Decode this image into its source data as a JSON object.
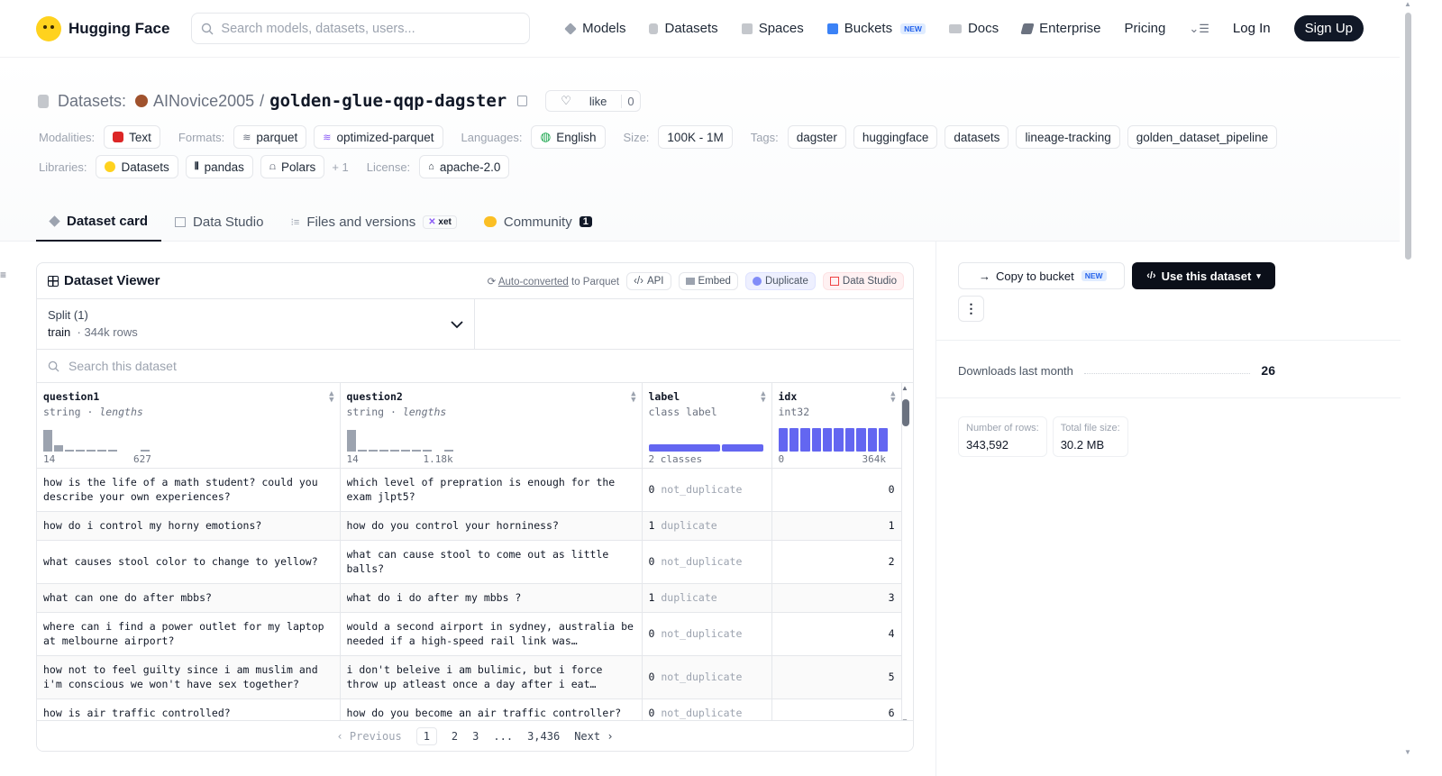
{
  "nav": {
    "brand": "Hugging Face",
    "search_placeholder": "Search models, datasets, users...",
    "links": [
      {
        "label": "Models",
        "color": "#9ca3af"
      },
      {
        "label": "Datasets",
        "color": "#9ca3af"
      },
      {
        "label": "Spaces",
        "color": "#9ca3af"
      },
      {
        "label": "Buckets",
        "color": "#3b82f6",
        "badge": "NEW"
      },
      {
        "label": "Docs",
        "color": "#9ca3af"
      },
      {
        "label": "Enterprise",
        "color": "#6b7280"
      },
      {
        "label": "Pricing"
      }
    ],
    "login": "Log In",
    "signup": "Sign Up"
  },
  "header": {
    "section_label": "Datasets:",
    "owner": "AINovice2005",
    "separator": "/",
    "name": "golden-glue-qqp-dagster",
    "like_label": "like",
    "like_count": "0",
    "modalities_label": "Modalities:",
    "modalities": [
      "Text"
    ],
    "formats_label": "Formats:",
    "formats": [
      "parquet",
      "optimized-parquet"
    ],
    "languages_label": "Languages:",
    "languages": [
      "English"
    ],
    "size_label": "Size:",
    "size": "100K - 1M",
    "tags_label": "Tags:",
    "tags": [
      "dagster",
      "huggingface",
      "datasets",
      "lineage-tracking",
      "golden_dataset_pipeline"
    ],
    "libraries_label": "Libraries:",
    "libraries": [
      "Datasets",
      "pandas",
      "Polars"
    ],
    "libraries_more": "+ 1",
    "license_label": "License:",
    "license": "apache-2.0"
  },
  "tabs": [
    {
      "label": "Dataset card",
      "active": true
    },
    {
      "label": "Data Studio"
    },
    {
      "label": "Files and versions",
      "badge": "xet"
    },
    {
      "label": "Community",
      "count": "1"
    }
  ],
  "viewer": {
    "title": "Dataset Viewer",
    "autoconv_link": "Auto-converted",
    "autoconv_rest": "to Parquet",
    "actions": [
      "API",
      "Embed",
      "Duplicate",
      "Data Studio"
    ],
    "split_title": "Split (1)",
    "split_name": "train",
    "split_rows": "344k rows",
    "search_placeholder": "Search this dataset",
    "columns": [
      {
        "name": "question1",
        "type": "string",
        "subtype": "lengths",
        "min": "14",
        "max": "627",
        "hist": [
          0.85,
          0.25,
          0.05,
          0.05,
          0.05,
          0.05,
          0.05,
          0,
          0,
          0.05
        ]
      },
      {
        "name": "question2",
        "type": "string",
        "subtype": "lengths",
        "min": "14",
        "max": "1.18k",
        "hist": [
          0.85,
          0.05,
          0.05,
          0.05,
          0.05,
          0.05,
          0.05,
          0.05,
          0,
          0.05
        ]
      },
      {
        "name": "label",
        "type": "class label",
        "subtype": "",
        "min": "2 classes",
        "max": "",
        "class_split": [
          0.63,
          0.37
        ]
      },
      {
        "name": "idx",
        "type": "int32",
        "subtype": "",
        "min": "0",
        "max": "364k",
        "bins": 10
      }
    ],
    "rows": [
      {
        "q1": "how is the life of a math student? could you describe your own experiences?",
        "q2": "which level of prepration is enough for the exam jlpt5?",
        "label_num": "0",
        "label_name": "not_duplicate",
        "idx": "0"
      },
      {
        "q1": "how do i control my horny emotions?",
        "q2": "how do you control your horniness?",
        "label_num": "1",
        "label_name": "duplicate",
        "idx": "1"
      },
      {
        "q1": "what causes stool color to change to yellow?",
        "q2": "what can cause stool to come out as little balls?",
        "label_num": "0",
        "label_name": "not_duplicate",
        "idx": "2"
      },
      {
        "q1": "what can one do after mbbs?",
        "q2": "what do i do after my mbbs ?",
        "label_num": "1",
        "label_name": "duplicate",
        "idx": "3"
      },
      {
        "q1": "where can i find a power outlet for my laptop at melbourne airport?",
        "q2": "would a second airport in sydney, australia be needed if a high-speed rail link was…",
        "label_num": "0",
        "label_name": "not_duplicate",
        "idx": "4"
      },
      {
        "q1": "how not to feel guilty since i am muslim and i'm conscious we won't have sex together?",
        "q2": "i don't beleive i am bulimic, but i force throw up atleast once a day after i eat…",
        "label_num": "0",
        "label_name": "not_duplicate",
        "idx": "5"
      },
      {
        "q1": "how is air traffic controlled?",
        "q2": "how do you become an air traffic controller?",
        "label_num": "0",
        "label_name": "not_duplicate",
        "idx": "6"
      }
    ],
    "pager": {
      "prev": "Previous",
      "pages": [
        "1",
        "2",
        "3",
        "...",
        "3,436"
      ],
      "next": "Next"
    }
  },
  "sidebar": {
    "copy_label": "Copy to bucket",
    "copy_badge": "NEW",
    "use_label": "Use this dataset",
    "downloads_label": "Downloads last month",
    "downloads_value": "26",
    "rows_label": "Number of rows:",
    "rows_value": "343,592",
    "size_label": "Total file size:",
    "size_value": "30.2 MB"
  }
}
